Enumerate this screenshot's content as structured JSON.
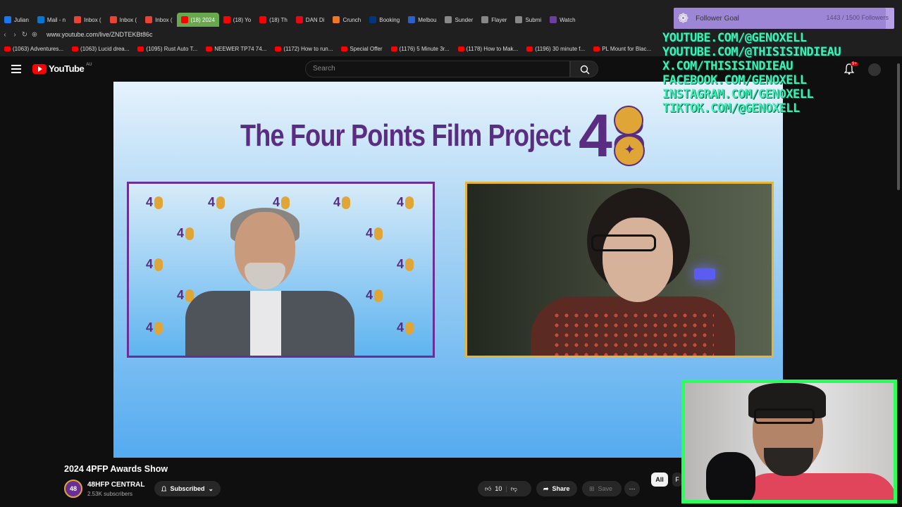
{
  "browser": {
    "tabs": [
      {
        "label": "Julian",
        "color": "#1877f2"
      },
      {
        "label": "Mail - n",
        "color": "#0078d4"
      },
      {
        "label": "Inbox (",
        "color": "#ea4335"
      },
      {
        "label": "Inbox (",
        "color": "#ea4335"
      },
      {
        "label": "Inbox (",
        "color": "#ea4335"
      },
      {
        "label": "(18) 2024",
        "color": "#ff0000",
        "active": true
      },
      {
        "label": "(18) Yo",
        "color": "#ff0000"
      },
      {
        "label": "(18) Th",
        "color": "#ff0000"
      },
      {
        "label": "DAN Di",
        "color": "#e50914"
      },
      {
        "label": "Crunch",
        "color": "#f47521"
      },
      {
        "label": "Booking",
        "color": "#003580"
      },
      {
        "label": "Melbou",
        "color": "#2a62c9"
      },
      {
        "label": "Sunder",
        "color": "#888888"
      },
      {
        "label": "Flayer",
        "color": "#888888"
      },
      {
        "label": "Submi",
        "color": "#888888"
      },
      {
        "label": "Watch",
        "color": "#6b3fa0"
      }
    ],
    "url": "www.youtube.com/live/ZNDTEKBt86c",
    "bookmarks": [
      "(1063) Adventures...",
      "(1063) Lucid drea...",
      "(1095) Rust Auto T...",
      "NEEWER TP74 74...",
      "(1172) How to run...",
      "Special Offer",
      "(1176) 5 Minute 3r...",
      "(1178) How to Mak...",
      "(1196) 30 minute f...",
      "PL Mount for Blac..."
    ]
  },
  "youtube": {
    "logo_text": "YouTube",
    "region": "AU",
    "search_placeholder": "Search",
    "notification_count": "9+"
  },
  "video": {
    "slide_title": "The Four Points Film Project",
    "logo_number": "48"
  },
  "overlay": {
    "follower_goal_label": "Follower Goal",
    "follower_count": "1443 / 1500 Followers",
    "follower_progress": 0.962,
    "socials": [
      "YOUTUBE.COM/@GENOXELL",
      "YOUTUBE.COM/@THISISINDIEAU",
      "X.COM/THISISINDIEAU",
      "FACEBOOK.COM/GENOXELL",
      "INSTAGRAM.COM/GENOXELL",
      "TIKTOK.COM/@GENOXELL"
    ]
  },
  "watch": {
    "title": "2024 4PFP Awards Show",
    "channel_name": "48HFP CENTRAL",
    "subscribers": "2.53K subscribers",
    "subscribed_label": "Subscribed",
    "like_count": "10",
    "share_label": "Share",
    "save_label": "Save",
    "chips": [
      "All",
      "F"
    ]
  }
}
